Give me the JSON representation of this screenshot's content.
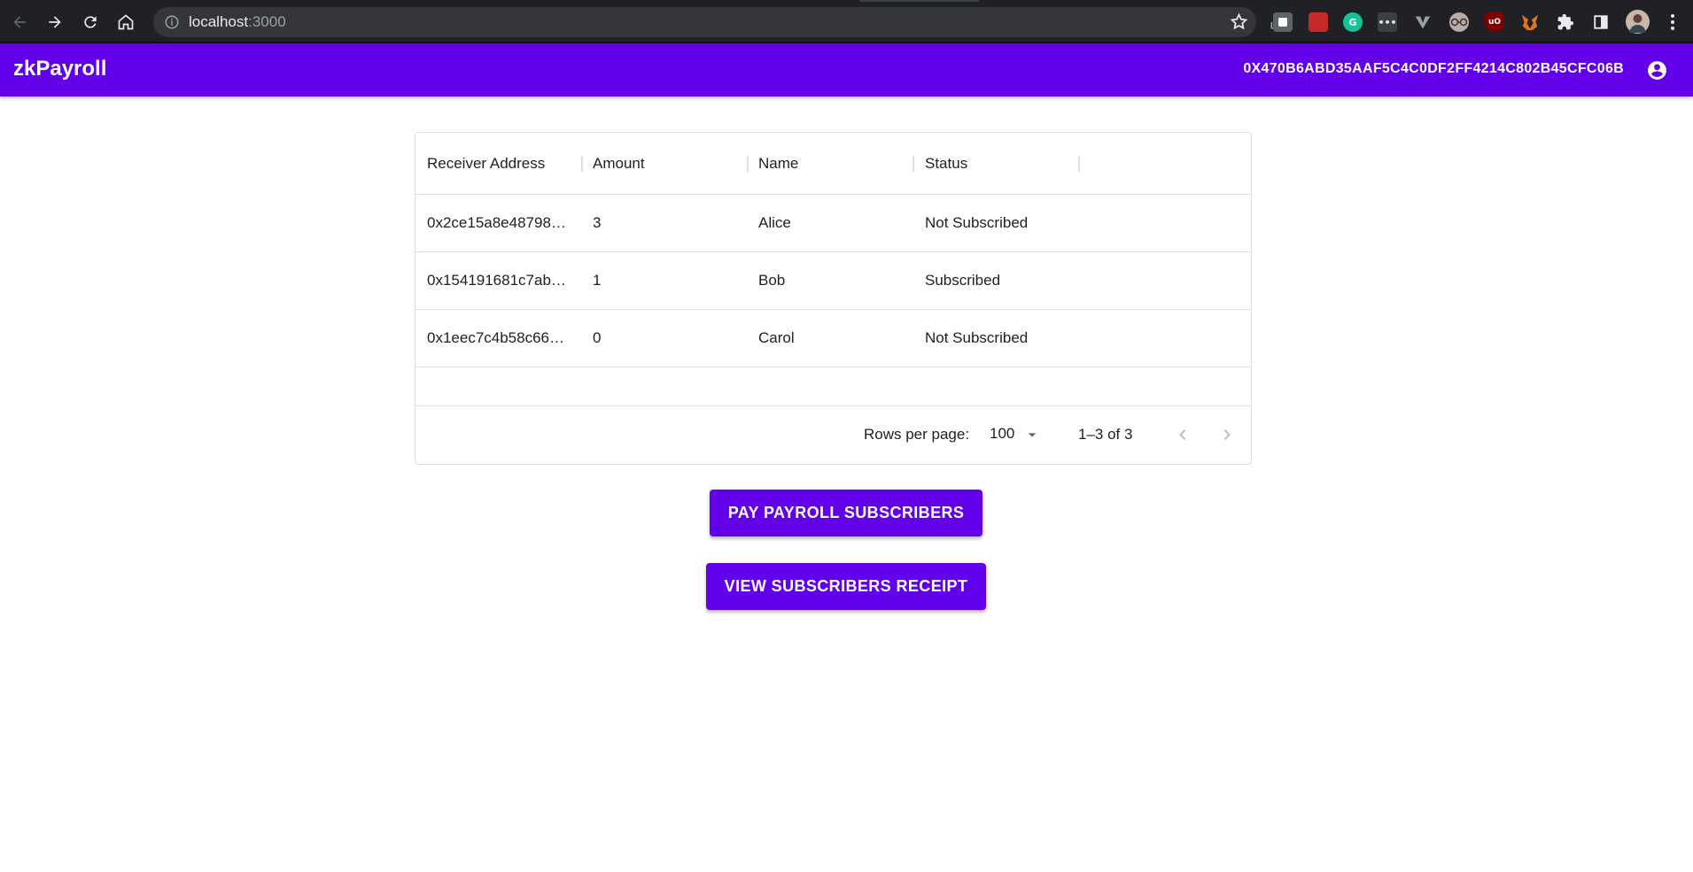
{
  "browser": {
    "url_host": "localhost",
    "url_port": ":3000",
    "extensions": [
      "tab-capture-icon",
      "bookmark-red-icon",
      "grammarly-icon",
      "dots-extension-icon",
      "vimium-icon",
      "glasses-extension-icon",
      "ublock-origin-icon",
      "metamask-icon",
      "extensions-puzzle-icon",
      "side-panel-icon",
      "profile-avatar-icon"
    ]
  },
  "app": {
    "title": "zkPayroll",
    "wallet_address": "0X470B6ABD35AAF5C4C0DF2FF4214C802B45CFC06B",
    "brand_color": "#6200ea"
  },
  "table": {
    "columns": [
      "Receiver Address",
      "Amount",
      "Name",
      "Status"
    ],
    "rows": [
      {
        "address": "0x2ce15a8e48798…",
        "amount": "3",
        "name": "Alice",
        "status": "Not Subscribed"
      },
      {
        "address": "0x154191681c7ab…",
        "amount": "1",
        "name": "Bob",
        "status": "Subscribed"
      },
      {
        "address": "0x1eec7c4b58c66…",
        "amount": "0",
        "name": "Carol",
        "status": "Not Subscribed"
      }
    ],
    "footer": {
      "rows_per_page_label": "Rows per page:",
      "rows_per_page_value": "100",
      "range": "1–3 of 3"
    }
  },
  "actions": {
    "pay_label": "PAY PAYROLL SUBSCRIBERS",
    "view_label": "VIEW SUBSCRIBERS RECEIPT"
  }
}
